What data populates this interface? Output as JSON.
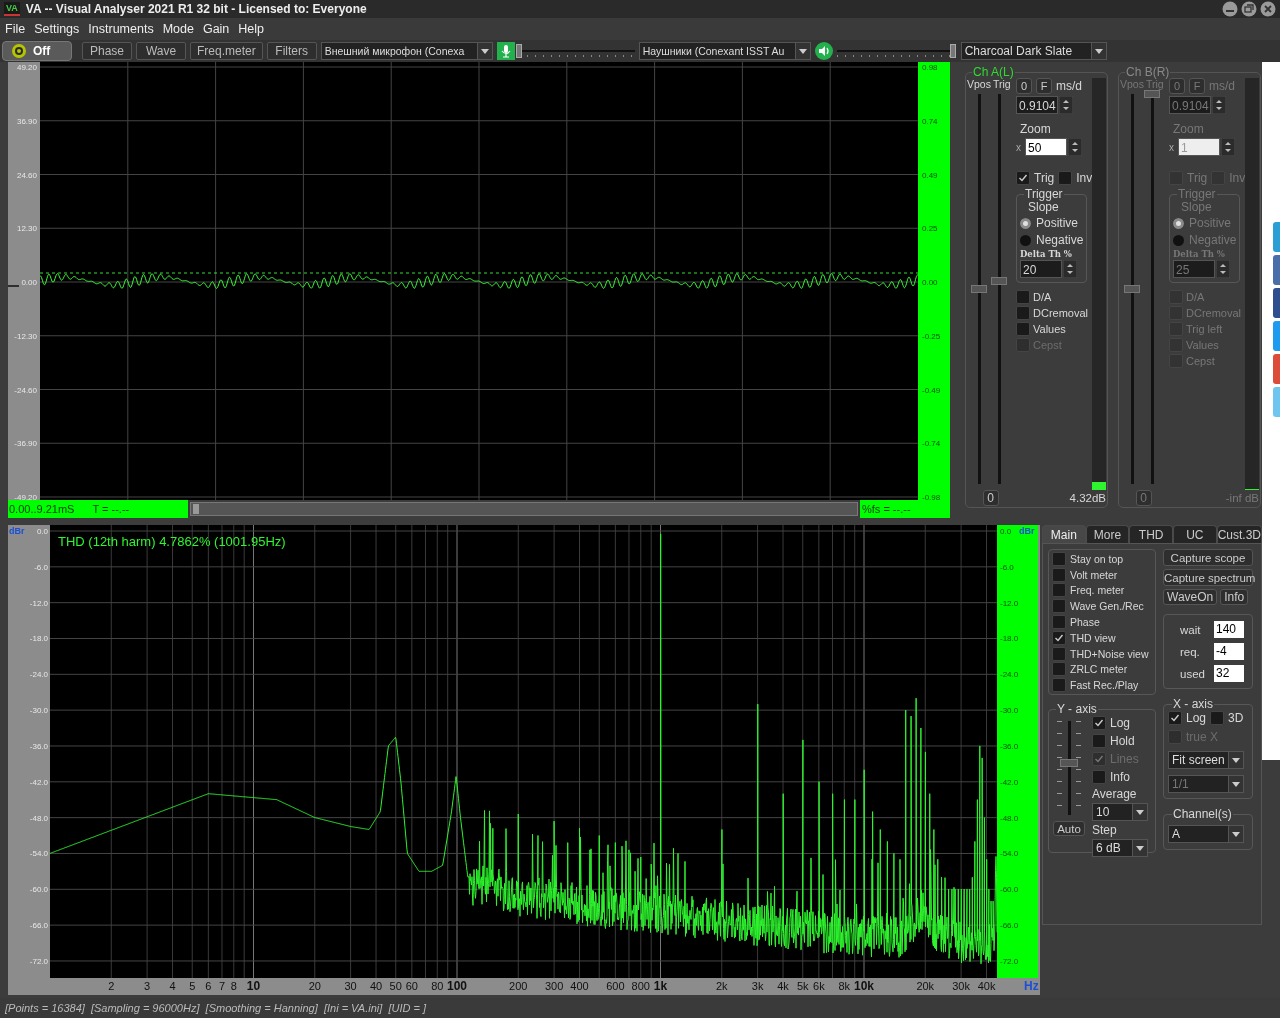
{
  "window": {
    "logo": "VA",
    "title": "VA -- Visual Analyser 2021 R1 32 bit - Licensed to: Everyone"
  },
  "menu": [
    "File",
    "Settings",
    "Instruments",
    "Mode",
    "Gain",
    "Help"
  ],
  "toolbar": {
    "power": {
      "label": "Off",
      "on": false
    },
    "buttons": [
      "Phase",
      "Wave",
      "Freq.meter",
      "Filters"
    ],
    "input_device": "Внешний микрофон (Conexa",
    "input_level": {
      "level": 0.0
    },
    "output_device": "Наушники (Conexant ISST Au",
    "output_level": {
      "level": 1.0
    },
    "theme": "Charcoal Dark Slate"
  },
  "scope": {
    "left_ticks": [
      "49.20",
      "36.90",
      "24.60",
      "12.30",
      "0.00",
      "-12.30",
      "-24.60",
      "-36.90",
      "-49.20"
    ],
    "right_ticks": [
      "0.98",
      "0.74",
      "0.49",
      "0.25",
      "0.00",
      "-0.25",
      "-0.49",
      "-0.74",
      "-0.98"
    ],
    "time_range": "0.00..9.21mS",
    "period": "T = --.--",
    "fs": "%fs = --.--"
  },
  "channels": [
    {
      "title": "Ch A(L)",
      "enabled": true,
      "vpos_label": "Vpos",
      "trig_label": "Trig",
      "vpos": {
        "level": 0.5
      },
      "trig": {
        "level": 0.52
      },
      "reset": "0",
      "zero": "0",
      "fine": "F",
      "ms_label": "ms/d",
      "ms_per_div": "0.9104",
      "zoom_label": "Zoom",
      "zoom_x": "x",
      "zoom": "50",
      "trig_check": {
        "label": "Trig",
        "checked": true
      },
      "inv_check": {
        "label": "Inv",
        "checked": false
      },
      "trigger_title": "Trigger",
      "slope_label": "Slope",
      "slopes": [
        {
          "label": "Positive",
          "selected": true
        },
        {
          "label": "Negative",
          "selected": false
        }
      ],
      "delta_label": "Delta Th %",
      "delta": "20",
      "options": [
        {
          "label": "D/A",
          "checked": false,
          "disabled": false
        },
        {
          "label": "DCremoval",
          "checked": false,
          "disabled": false
        },
        {
          "label": "Values",
          "checked": false,
          "disabled": false
        },
        {
          "label": "Cepst",
          "checked": false,
          "disabled": true
        }
      ],
      "meter": {
        "level": 0.02
      },
      "reading": "4.32dB"
    },
    {
      "title": "Ch B(R)",
      "enabled": false,
      "vpos_label": "Vpos",
      "trig_label": "Trig",
      "vpos": {
        "level": 0.5
      },
      "trig": {
        "level": 1.0
      },
      "reset": "0",
      "zero": "0",
      "fine": "F",
      "ms_label": "ms/d",
      "ms_per_div": "0.9104",
      "zoom_label": "Zoom",
      "zoom_x": "x",
      "zoom": "1",
      "trig_check": {
        "label": "Trig",
        "checked": false
      },
      "inv_check": {
        "label": "Inv",
        "checked": false
      },
      "trigger_title": "Trigger",
      "slope_label": "Slope",
      "slopes": [
        {
          "label": "Positive",
          "selected": true
        },
        {
          "label": "Negative",
          "selected": false
        }
      ],
      "delta_label": "Delta Th %",
      "delta": "25",
      "options": [
        {
          "label": "D/A",
          "checked": false
        },
        {
          "label": "DCremoval",
          "checked": false
        },
        {
          "label": "Trig left",
          "checked": false
        },
        {
          "label": "Values",
          "checked": false
        },
        {
          "label": "Cepst",
          "checked": false
        }
      ],
      "meter": {
        "level": 0.0
      },
      "reading": "-inf dB"
    }
  ],
  "spectrum": {
    "thd_label": "THD (12th harm) 4.7862% (1001.95Hz)",
    "left_unit": "dBr",
    "right_unit": "dBr",
    "left_ticks": [
      "0.0",
      "-6.0",
      "-12.0",
      "-18.0",
      "-24.0",
      "-30.0",
      "-36.0",
      "-42.0",
      "-48.0",
      "-54.0",
      "-60.0",
      "-66.0",
      "-72.0"
    ],
    "right_ticks": [
      "0.0",
      "-6.0",
      "-12.0",
      "-18.0",
      "-24.0",
      "-30.0",
      "-36.0",
      "-42.0",
      "-48.0",
      "-54.0",
      "-60.0",
      "-66.0",
      "-72.0"
    ],
    "x_ticks": [
      {
        "label": "2",
        "major": false
      },
      {
        "label": "3",
        "major": false
      },
      {
        "label": "4",
        "major": false
      },
      {
        "label": "5",
        "major": false
      },
      {
        "label": "6",
        "major": false
      },
      {
        "label": "7",
        "major": false
      },
      {
        "label": "8",
        "major": false
      },
      {
        "label": "10",
        "major": true
      },
      {
        "label": "20",
        "major": false
      },
      {
        "label": "30",
        "major": false
      },
      {
        "label": "40",
        "major": false
      },
      {
        "label": "50",
        "major": false
      },
      {
        "label": "60",
        "major": false
      },
      {
        "label": "80",
        "major": false
      },
      {
        "label": "100",
        "major": true
      },
      {
        "label": "200",
        "major": false
      },
      {
        "label": "300",
        "major": false
      },
      {
        "label": "400",
        "major": false
      },
      {
        "label": "600",
        "major": false
      },
      {
        "label": "800",
        "major": false
      },
      {
        "label": "1k",
        "major": true
      },
      {
        "label": "2k",
        "major": false
      },
      {
        "label": "3k",
        "major": false
      },
      {
        "label": "4k",
        "major": false
      },
      {
        "label": "5k",
        "major": false
      },
      {
        "label": "6k",
        "major": false
      },
      {
        "label": "8k",
        "major": false
      },
      {
        "label": "10k",
        "major": true
      },
      {
        "label": "20k",
        "major": false
      },
      {
        "label": "30k",
        "major": false
      },
      {
        "label": "40k",
        "major": false
      }
    ],
    "x_unit": "Hz"
  },
  "analyzer_panel": {
    "tabs": [
      {
        "label": "Main",
        "selected": true
      },
      {
        "label": "More",
        "selected": false
      },
      {
        "label": "THD",
        "selected": false
      },
      {
        "label": "UC",
        "selected": false
      },
      {
        "label": "Cust.3D",
        "selected": false
      }
    ],
    "options": [
      {
        "label": "Stay on top",
        "checked": false
      },
      {
        "label": "Volt meter",
        "checked": false
      },
      {
        "label": "Freq. meter",
        "checked": false
      },
      {
        "label": "Wave Gen./Rec",
        "checked": false
      },
      {
        "label": "Phase",
        "checked": false
      },
      {
        "label": "THD view",
        "checked": true
      },
      {
        "label": "THD+Noise view",
        "checked": false
      },
      {
        "label": "ZRLC meter",
        "checked": false
      },
      {
        "label": "Fast Rec./Play",
        "checked": false
      }
    ],
    "buttons": [
      "Capture scope",
      "Capture spectrum",
      "WaveOn",
      "Info"
    ],
    "fields": [
      {
        "label": "wait",
        "value": "140"
      },
      {
        "label": "req.",
        "value": "-4"
      },
      {
        "label": "used",
        "value": "32"
      }
    ],
    "y_axis": {
      "title": "Y - axis",
      "slider": {
        "level": 0.55
      },
      "checks": [
        {
          "label": "Log",
          "checked": true,
          "disabled": false
        },
        {
          "label": "Hold",
          "checked": false,
          "disabled": false
        },
        {
          "label": "Lines",
          "checked": true,
          "disabled": true
        },
        {
          "label": "Info",
          "checked": false,
          "disabled": false
        }
      ],
      "average_label": "Average",
      "average": "10",
      "step_label": "Step",
      "step": "6 dB",
      "auto": "Auto"
    },
    "x_axis": {
      "title": "X - axis",
      "checks": [
        {
          "label": "Log",
          "checked": true,
          "disabled": false
        },
        {
          "label": "3D",
          "checked": false,
          "disabled": false
        },
        {
          "label": "true X",
          "checked": false,
          "disabled": true
        }
      ],
      "scale": {
        "value": "Fit screen",
        "disabled": false
      },
      "ratio": {
        "value": "1/1",
        "disabled": true
      }
    },
    "channel_select": {
      "title": "Channel(s)",
      "value": "A"
    }
  },
  "page_edge": {
    "tabs": [
      {
        "color": "#2a9fd6"
      },
      {
        "color": "#4a6ea9"
      },
      {
        "color": "#2e4f8f"
      },
      {
        "color": "#1d9bf0"
      },
      {
        "color": "#dd4b39"
      },
      {
        "color": "#6ec6f0"
      }
    ]
  },
  "status_bar": "[Points = 16384]  [Sampling = 96000Hz]  [Smoothing = Hanning]  [Ini = VA.ini]  [UID = ]"
}
